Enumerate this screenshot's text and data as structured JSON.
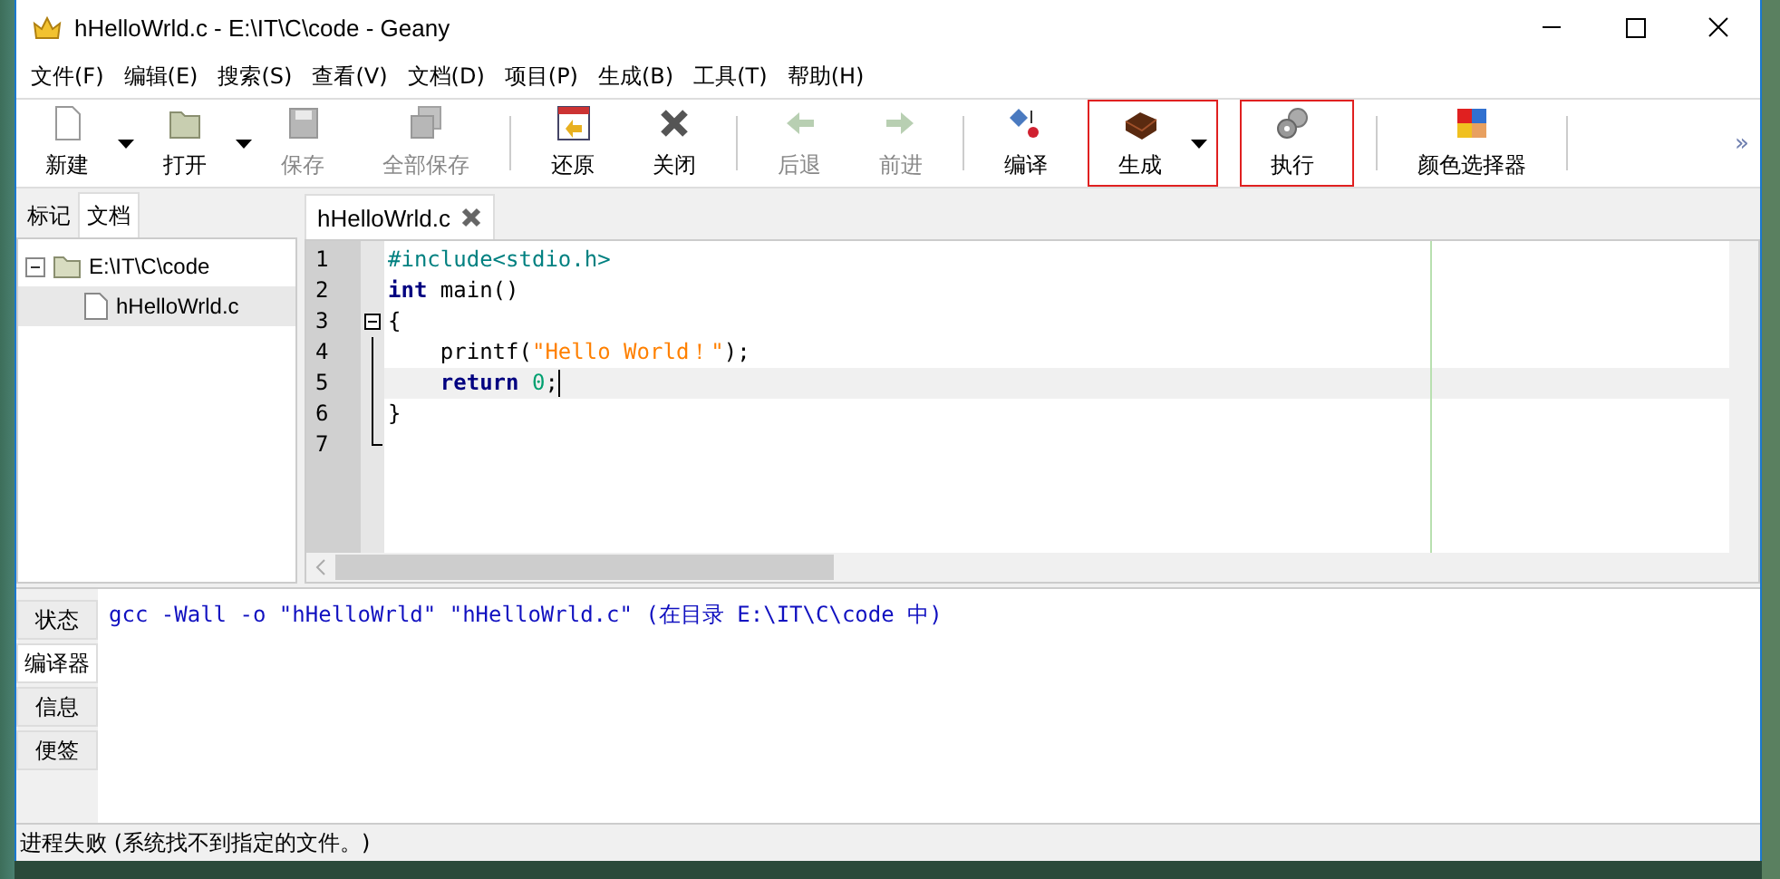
{
  "window": {
    "title": "hHelloWrld.c - E:\\IT\\C\\code - Geany"
  },
  "menu": [
    {
      "label": "文件(F)"
    },
    {
      "label": "编辑(E)"
    },
    {
      "label": "搜索(S)"
    },
    {
      "label": "查看(V)"
    },
    {
      "label": "文档(D)"
    },
    {
      "label": "项目(P)"
    },
    {
      "label": "生成(B)"
    },
    {
      "label": "工具(T)"
    },
    {
      "label": "帮助(H)"
    }
  ],
  "toolbar": [
    {
      "kind": "button",
      "label": "新建",
      "disabled": false,
      "dropdown": true,
      "highlighted": false
    },
    {
      "kind": "button",
      "label": "打开",
      "disabled": false,
      "dropdown": true,
      "highlighted": false
    },
    {
      "kind": "button",
      "label": "保存",
      "disabled": true,
      "dropdown": false,
      "highlighted": false
    },
    {
      "kind": "button",
      "label": "全部保存",
      "disabled": true,
      "dropdown": false,
      "highlighted": false
    },
    {
      "kind": "separator"
    },
    {
      "kind": "button",
      "label": "还原",
      "disabled": false,
      "dropdown": false,
      "highlighted": false
    },
    {
      "kind": "button",
      "label": "关闭",
      "disabled": false,
      "dropdown": false,
      "highlighted": false
    },
    {
      "kind": "separator"
    },
    {
      "kind": "button",
      "label": "后退",
      "disabled": true,
      "dropdown": false,
      "highlighted": false
    },
    {
      "kind": "button",
      "label": "前进",
      "disabled": true,
      "dropdown": false,
      "highlighted": false
    },
    {
      "kind": "separator"
    },
    {
      "kind": "button",
      "label": "编译",
      "disabled": false,
      "dropdown": false,
      "highlighted": false
    },
    {
      "kind": "button",
      "label": "生成",
      "disabled": false,
      "dropdown": true,
      "highlighted": true
    },
    {
      "kind": "button",
      "label": "执行",
      "disabled": false,
      "dropdown": false,
      "highlighted": true
    },
    {
      "kind": "separator"
    },
    {
      "kind": "button",
      "label": "颜色选择器",
      "disabled": false,
      "dropdown": false,
      "highlighted": false
    },
    {
      "kind": "separator"
    }
  ],
  "overflow": {
    "label": "»"
  },
  "sidebar": {
    "tabs": [
      {
        "label": "标记",
        "selected": false
      },
      {
        "label": "文档",
        "selected": true
      }
    ],
    "tree": [
      {
        "label": "E:\\IT\\C\\code",
        "expanded": true,
        "selected": false,
        "children": [
          {
            "label": "hHelloWrld.c",
            "selected": true
          }
        ]
      }
    ]
  },
  "editor": {
    "tab": {
      "label": "hHelloWrld.c"
    },
    "lines": [
      {
        "number": "1",
        "fold_point": false,
        "current": false,
        "segments": [
          {
            "kind": "preprocessor",
            "text": "#include<stdio.h>"
          }
        ]
      },
      {
        "number": "2",
        "fold_point": false,
        "current": false,
        "segments": [
          {
            "kind": "keyword",
            "text": "int"
          },
          {
            "kind": "plain",
            "text": " main()"
          }
        ]
      },
      {
        "number": "3",
        "fold_point": true,
        "current": false,
        "segments": [
          {
            "kind": "plain",
            "text": "{"
          }
        ]
      },
      {
        "number": "4",
        "fold_point": false,
        "current": false,
        "segments": [
          {
            "kind": "plain",
            "text": "    printf("
          },
          {
            "kind": "string",
            "text": "\"Hello World！\""
          },
          {
            "kind": "plain",
            "text": ");"
          }
        ]
      },
      {
        "number": "5",
        "fold_point": false,
        "current": true,
        "segments": [
          {
            "kind": "keyword",
            "text": "    return"
          },
          {
            "kind": "number",
            "text": " 0"
          },
          {
            "kind": "plain",
            "text": ";"
          }
        ]
      },
      {
        "number": "6",
        "fold_point": false,
        "current": false,
        "segments": [
          {
            "kind": "plain",
            "text": "}"
          }
        ]
      },
      {
        "number": "7",
        "fold_point": false,
        "current": false
      }
    ]
  },
  "messages": {
    "tabs": [
      {
        "label": "状态",
        "selected": false
      },
      {
        "label": "编译器",
        "selected": true
      },
      {
        "label": "信息",
        "selected": false
      },
      {
        "label": "便签",
        "selected": false
      }
    ],
    "lines": [
      "gcc -Wall -o \"hHelloWrld\" \"hHelloWrld.c\" (在目录 E:\\IT\\C\\code 中)"
    ]
  },
  "status_bar": {
    "text": "进程失败 (系统找不到指定的文件。)"
  }
}
